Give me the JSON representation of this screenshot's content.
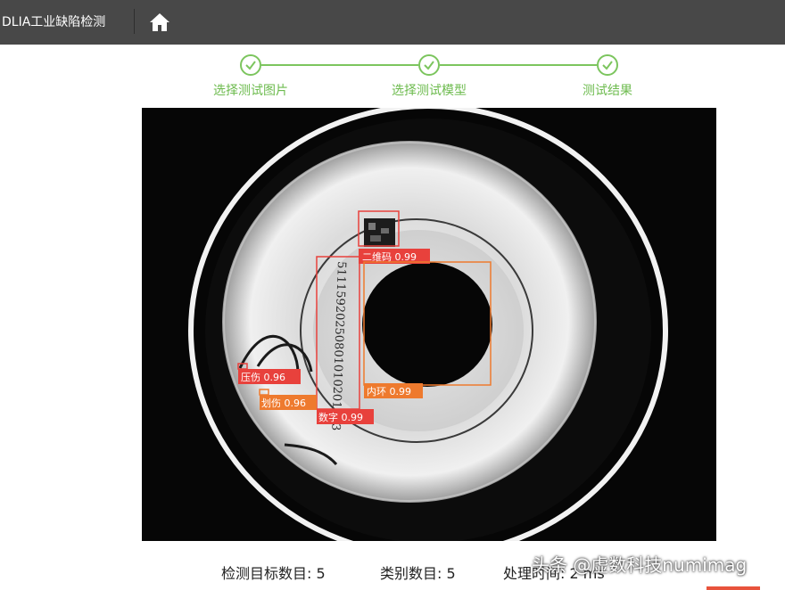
{
  "header": {
    "app_title": "DLIA工业缺陷检测",
    "home_icon": "home-icon"
  },
  "stepper": {
    "steps": [
      {
        "label": "选择测试图片",
        "state": "done"
      },
      {
        "label": "选择测试模型",
        "state": "done"
      },
      {
        "label": "测试结果",
        "state": "done"
      }
    ],
    "color": "#7cc55e"
  },
  "image": {
    "part_engraving": "51115920250801010201083",
    "detections": [
      {
        "label": "二维码 0.99",
        "color": "#e8413c"
      },
      {
        "label": "内环 0.99",
        "color": "#ee7a2e"
      },
      {
        "label": "数字 0.99",
        "color": "#e8413c"
      },
      {
        "label": "压伤 0.96",
        "color": "#e8413c"
      },
      {
        "label": "划伤 0.96",
        "color": "#ee7a2e"
      }
    ]
  },
  "stats": {
    "targets": "检测目标数目: 5",
    "categories": "类别数目: 5",
    "time": "处理时间: 2 ms"
  },
  "watermark": "头条 @虚数科技numimag"
}
